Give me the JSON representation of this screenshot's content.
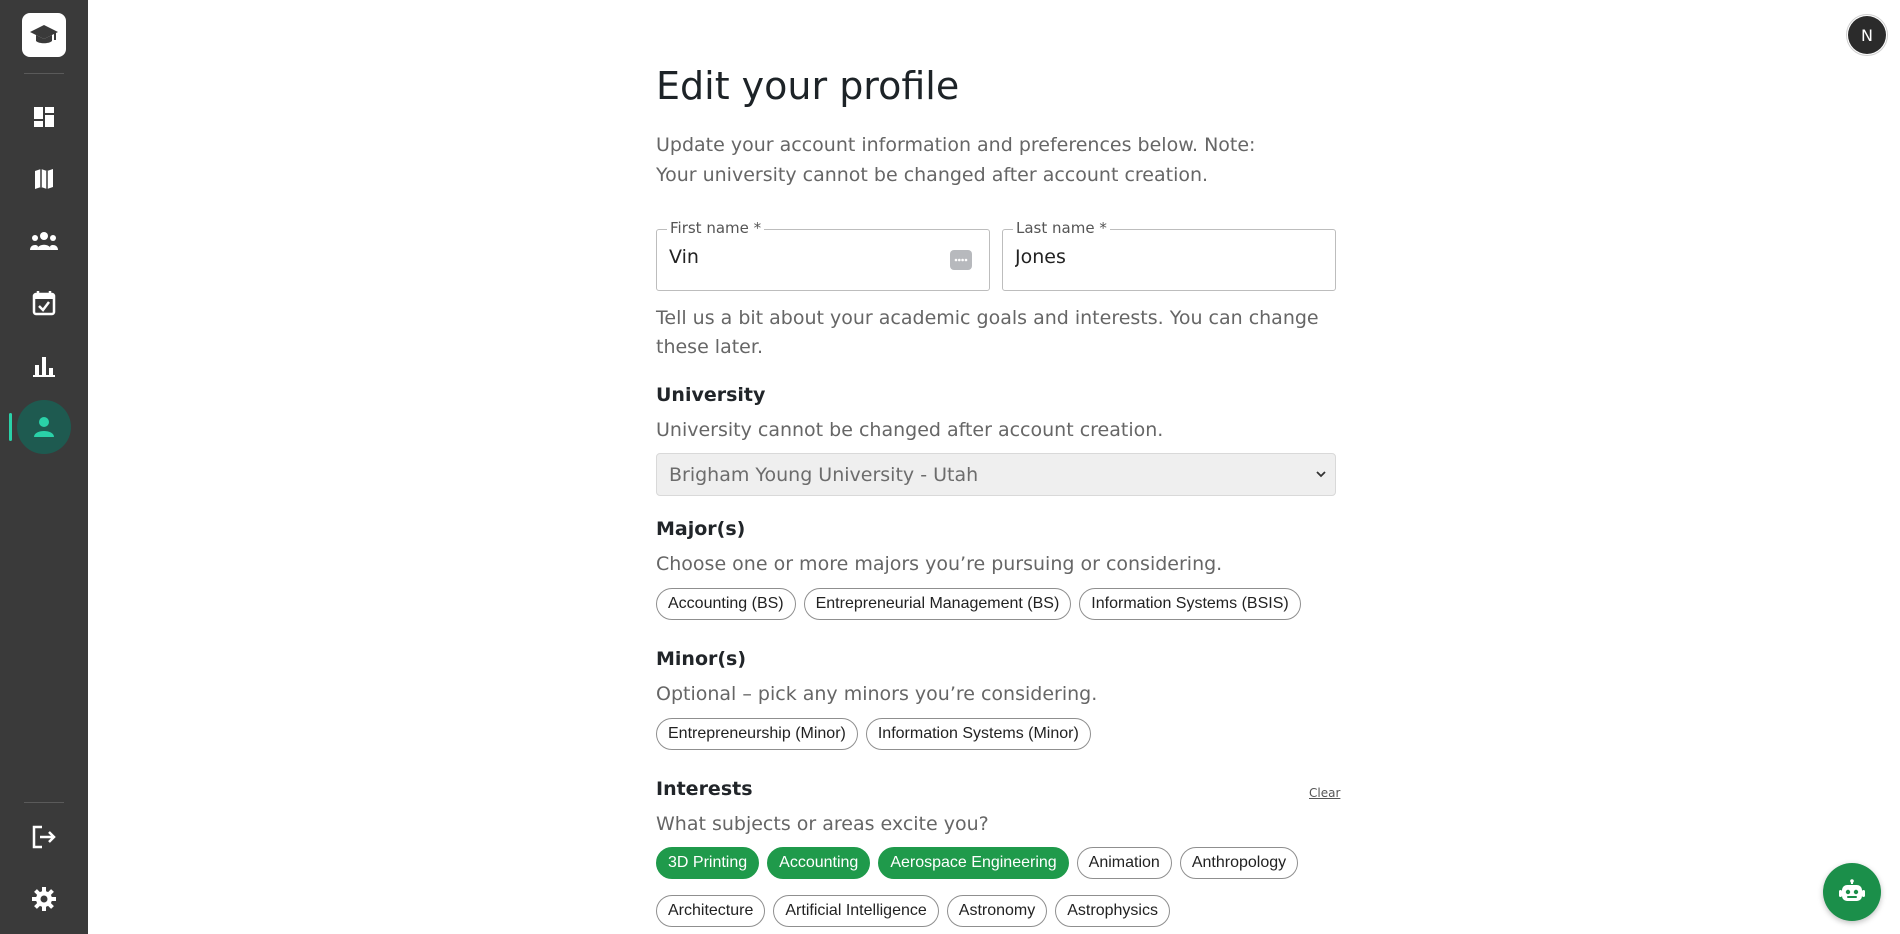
{
  "header": {
    "avatar_initial": "N"
  },
  "sidebar": {
    "items": [
      {
        "name": "dashboard"
      },
      {
        "name": "map"
      },
      {
        "name": "people"
      },
      {
        "name": "calendar"
      },
      {
        "name": "chart"
      },
      {
        "name": "profile",
        "active": true
      }
    ],
    "bottom": [
      {
        "name": "logout"
      },
      {
        "name": "settings"
      }
    ]
  },
  "page": {
    "title": "Edit your profile",
    "intro": "Update your account information and preferences below. Note: Your university cannot be changed after account creation."
  },
  "form": {
    "first_name": {
      "label": "First name *",
      "value": "Vin"
    },
    "last_name": {
      "label": "Last name *",
      "value": "Jones"
    },
    "goals_text": "Tell us a bit about your academic goals and interests. You can change these later.",
    "university": {
      "title": "University",
      "help": "University cannot be changed after account creation.",
      "selected": "Brigham Young University - Utah"
    },
    "majors": {
      "title": "Major(s)",
      "help": "Choose one or more majors you’re pursuing or considering.",
      "options": [
        "Accounting (BS)",
        "Entrepreneurial Management (BS)",
        "Information Systems (BSIS)"
      ]
    },
    "minors": {
      "title": "Minor(s)",
      "help": "Optional – pick any minors you’re considering.",
      "options": [
        "Entrepreneurship (Minor)",
        "Information Systems (Minor)"
      ]
    },
    "interests": {
      "title": "Interests",
      "clear_label": "Clear",
      "help": "What subjects or areas excite you?",
      "row1": [
        {
          "label": "3D Printing",
          "selected": true
        },
        {
          "label": "Accounting",
          "selected": true
        },
        {
          "label": "Aerospace Engineering",
          "selected": true
        },
        {
          "label": "Animation",
          "selected": false
        },
        {
          "label": "Anthropology",
          "selected": false
        }
      ],
      "row2": [
        {
          "label": "Architecture",
          "selected": false
        },
        {
          "label": "Artificial Intelligence",
          "selected": false
        },
        {
          "label": "Astronomy",
          "selected": false
        },
        {
          "label": "Astrophysics",
          "selected": false
        }
      ]
    }
  },
  "colors": {
    "sidebar": "#3a3a3a",
    "accent": "#2ad1a8",
    "chip_selected": "#1f9a4b"
  }
}
